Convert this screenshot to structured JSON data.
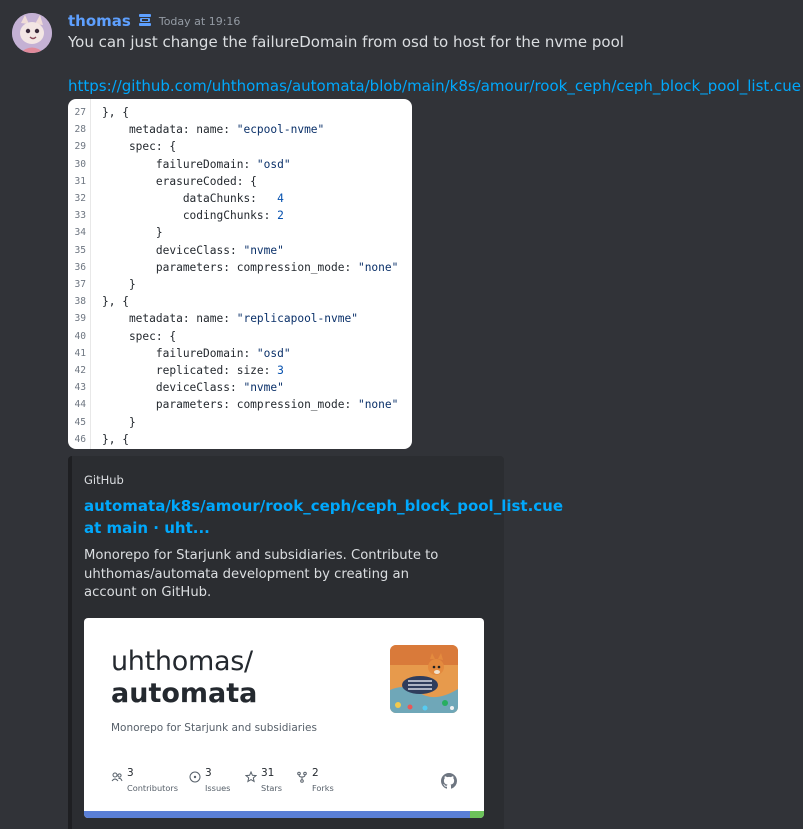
{
  "message": {
    "username": "thomas",
    "timestamp": "Today at 19:16",
    "text": "You can just change the failureDomain from osd to host for the nvme pool",
    "link": "https://github.com/uhthomas/automata/blob/main/k8s/amour/rook_ceph/ceph_block_pool_list.cue"
  },
  "code": {
    "lines": [
      {
        "n": "27",
        "t": "}, {"
      },
      {
        "n": "28",
        "t": "    metadata: name: \"ecpool-nvme\""
      },
      {
        "n": "29",
        "t": "    spec: {"
      },
      {
        "n": "30",
        "t": "        failureDomain: \"osd\""
      },
      {
        "n": "31",
        "t": "        erasureCoded: {"
      },
      {
        "n": "32",
        "t": "            dataChunks:   4"
      },
      {
        "n": "33",
        "t": "            codingChunks: 2"
      },
      {
        "n": "34",
        "t": "        }"
      },
      {
        "n": "35",
        "t": "        deviceClass: \"nvme\""
      },
      {
        "n": "36",
        "t": "        parameters: compression_mode: \"none\""
      },
      {
        "n": "37",
        "t": "    }"
      },
      {
        "n": "38",
        "t": "}, {"
      },
      {
        "n": "39",
        "t": "    metadata: name: \"replicapool-nvme\""
      },
      {
        "n": "40",
        "t": "    spec: {"
      },
      {
        "n": "41",
        "t": "        failureDomain: \"osd\""
      },
      {
        "n": "42",
        "t": "        replicated: size: 3"
      },
      {
        "n": "43",
        "t": "        deviceClass: \"nvme\""
      },
      {
        "n": "44",
        "t": "        parameters: compression_mode: \"none\""
      },
      {
        "n": "45",
        "t": "    }"
      },
      {
        "n": "46",
        "t": "}, {"
      }
    ]
  },
  "embed": {
    "provider": "GitHub",
    "title": "automata/k8s/amour/rook_ceph/ceph_block_pool_list.cue at main · uht...",
    "description": "Monorepo for Starjunk and subsidiaries. Contribute to uhthomas/automata development by creating an account on GitHub.",
    "card": {
      "owner": "uhthomas/",
      "repo": "automata",
      "description": "Monorepo for Starjunk and subsidiaries",
      "stats": [
        {
          "icon": "people-icon",
          "value": "3",
          "label": "Contributors"
        },
        {
          "icon": "issue-icon",
          "value": "3",
          "label": "Issues"
        },
        {
          "icon": "star-icon",
          "value": "31",
          "label": "Stars"
        },
        {
          "icon": "fork-icon",
          "value": "2",
          "label": "Forks"
        }
      ],
      "language_bar_colors": [
        "#5a7fd6",
        "#6cc25a"
      ],
      "language_bar_shares": [
        0.965,
        0.035
      ]
    }
  },
  "colors": {
    "background": "#313338",
    "username": "#5ea0ff",
    "link": "#00a8fc",
    "embed_bg": "#2b2d31"
  }
}
